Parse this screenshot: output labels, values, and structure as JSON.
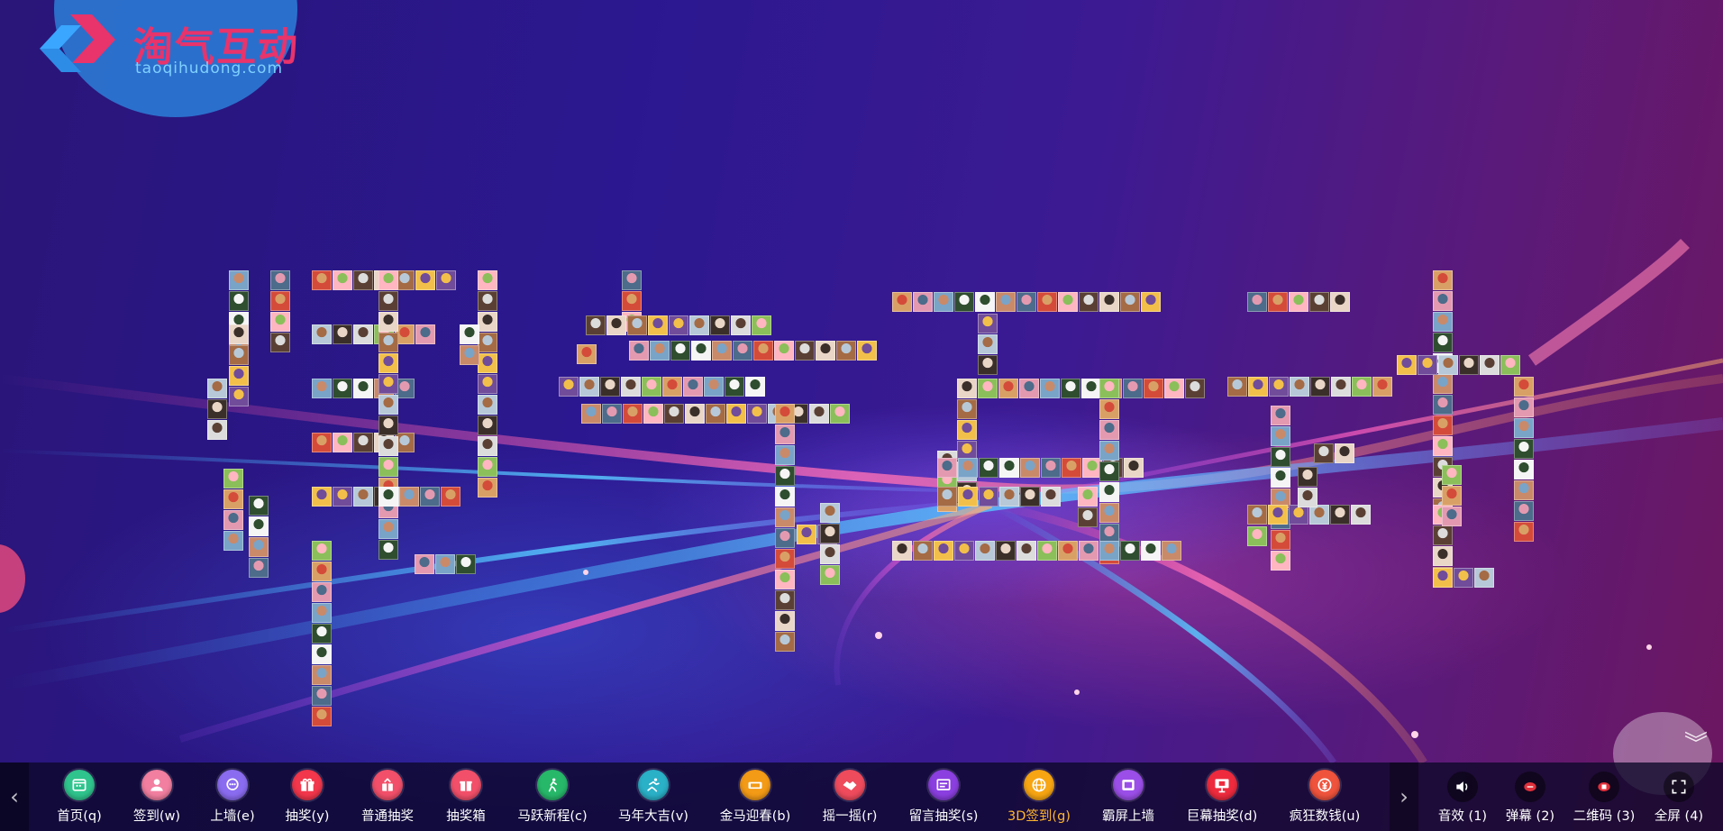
{
  "logo": {
    "title": "淘气互动",
    "subtitle": "taoqihudong.com"
  },
  "colors": {
    "brand_pink": "#e8336b",
    "accent_active": "#ffb62e",
    "logo_halo": "#2b7fd9"
  },
  "wall": {
    "characters": [
      "淘",
      "气",
      "互",
      "动"
    ]
  },
  "toolbar": {
    "items": [
      {
        "label": "首页(q)",
        "icon": "calendar-icon",
        "color": "#2fc48d"
      },
      {
        "label": "签到(w)",
        "icon": "user-icon",
        "color": "#f27fa0"
      },
      {
        "label": "上墙(e)",
        "icon": "chat-bubble-icon",
        "color": "#8a6cf0"
      },
      {
        "label": "抽奖(y)",
        "icon": "gift-icon",
        "color": "#f2364b"
      },
      {
        "label": "普通抽奖",
        "icon": "lottery-icon",
        "color": "#f2506a"
      },
      {
        "label": "抽奖箱",
        "icon": "prize-box-icon",
        "color": "#f2506a"
      },
      {
        "label": "马跃新程(c)",
        "icon": "runner-icon",
        "color": "#27b86a"
      },
      {
        "label": "马年大吉(v)",
        "icon": "sprint-icon",
        "color": "#2ab0c7"
      },
      {
        "label": "金马迎春(b)",
        "icon": "horse-icon",
        "color": "#f39a16"
      },
      {
        "label": "摇一摇(r)",
        "icon": "handshake-icon",
        "color": "#ee4b5d"
      },
      {
        "label": "留言抽奖(s)",
        "icon": "message-icon",
        "color": "#8b3fe0"
      },
      {
        "label": "3D签到(g)",
        "icon": "globe-icon",
        "color": "#f7a512",
        "active": true
      },
      {
        "label": "霸屏上墙",
        "icon": "ba-badge-icon",
        "color": "#9b4fe8"
      },
      {
        "label": "巨幕抽奖(d)",
        "icon": "presentation-icon",
        "color": "#ee2b3e"
      },
      {
        "label": "疯狂数钱(u)",
        "icon": "money-icon",
        "color": "#f0533c"
      }
    ],
    "aux": [
      {
        "label": "音效 (1)",
        "icon": "speaker-icon"
      },
      {
        "label": "弹幕 (2)",
        "icon": "danmaku-icon"
      },
      {
        "label": "二维码 (3)",
        "icon": "qrcode-icon"
      },
      {
        "label": "全屏 (4)",
        "icon": "fullscreen-icon"
      }
    ]
  }
}
